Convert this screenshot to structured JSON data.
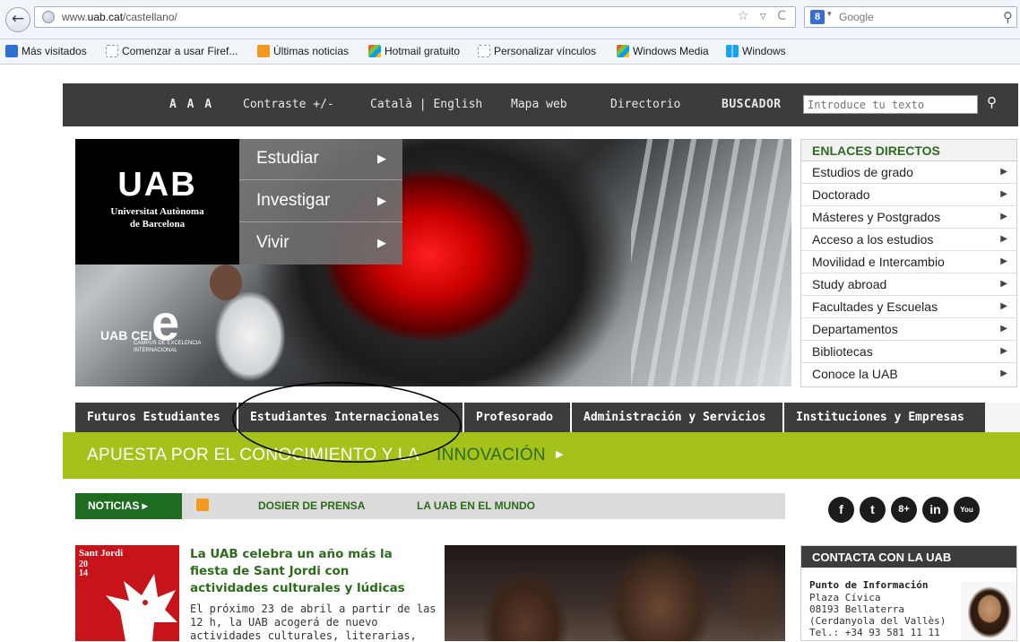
{
  "browser": {
    "back_icon": "back-arrow-icon",
    "url_prefix": "www.",
    "url_domain": "uab.cat",
    "url_path": "/castellano/",
    "url_icons": "☆ ▿ C",
    "search_engine_letter": "8",
    "search_engine_name": "Google",
    "bookmarks": [
      {
        "label": "Más visitados",
        "icon": "most-visited-icon"
      },
      {
        "label": "Comenzar a usar Firef...",
        "icon": "blank-page-icon"
      },
      {
        "label": "Últimas noticias",
        "icon": "rss-icon"
      },
      {
        "label": "Hotmail gratuito",
        "icon": "msn-butterfly-icon"
      },
      {
        "label": "Personalizar vínculos",
        "icon": "blank-page-icon"
      },
      {
        "label": "Windows Media",
        "icon": "msn-butterfly-icon"
      },
      {
        "label": "Windows",
        "icon": "windows-logo-icon"
      }
    ]
  },
  "util_bar": {
    "font_size": "A A A",
    "contrast": "Contraste +/-",
    "languages": "Català | English",
    "sitemap": "Mapa web",
    "directory": "Directorio",
    "search_label": "BUSCADOR",
    "search_placeholder": "Introduce tu texto"
  },
  "hero": {
    "logo_mark": "UAB",
    "logo_line1": "Universitat Autònoma",
    "logo_line2": "de Barcelona",
    "cei_letter": "e",
    "cei_uab": "UAB CEI",
    "cei_line1": "CAMPUS DE EXCELENCIA",
    "cei_line2": "INTERNACIONAL",
    "menu": [
      {
        "label": "Estudiar",
        "arrow": "▶"
      },
      {
        "label": "Investigar",
        "arrow": "▶"
      },
      {
        "label": "Vivir",
        "arrow": "▶"
      }
    ]
  },
  "enlaces": {
    "title": "ENLACES DIRECTOS",
    "arrow": "▶",
    "items": [
      "Estudios de grado",
      "Doctorado",
      "Másteres y Postgrados",
      "Acceso a los estudios",
      "Movilidad e Intercambio",
      "Study abroad",
      "Facultades y Escuelas",
      "Departamentos",
      "Bibliotecas",
      "Conoce la UAB"
    ]
  },
  "audience": [
    "Futuros Estudiantes",
    "Estudiantes Internacionales",
    "Profesorado",
    "Administración y Servicios",
    "Instituciones y Empresas"
  ],
  "banner": {
    "text_1": "APUESTA POR EL CONOCIMIENTO Y LA",
    "text_2": "INNOVACIÓN",
    "arrow": "▶"
  },
  "news_tabs": {
    "noticias": "NOTICIAS ▸",
    "dosier": "DOSIER DE PRENSA",
    "mundo": "LA UAB EN EL MUNDO"
  },
  "social": [
    {
      "icon": "facebook-icon",
      "glyph": "f"
    },
    {
      "icon": "twitter-icon",
      "glyph": "t"
    },
    {
      "icon": "googleplus-icon",
      "glyph": "8+"
    },
    {
      "icon": "linkedin-icon",
      "glyph": "in"
    },
    {
      "icon": "youtube-icon",
      "glyph": "You"
    }
  ],
  "news": {
    "thumb_title": "Sant Jordi",
    "thumb_year_1": "20",
    "thumb_year_2": "14",
    "headline_1": "La UAB celebra un año más la",
    "headline_2": "fiesta de Sant Jordi con",
    "headline_3": "actividades culturales y lúdicas",
    "body": [
      "El próximo 23 de abril a partir de las",
      "12 h, la UAB acogerá de nuevo",
      "actividades culturales, literarias,"
    ]
  },
  "contacta": {
    "title": "CONTACTA CON LA UAB",
    "heading": "Punto de Información",
    "lines": [
      "Plaza Cívica",
      "08193 Bellaterra",
      "(Cerdanyola del Vallès)",
      "Tel.: +34 93 581 11 11"
    ]
  },
  "colors": {
    "dark_bar": "#3c3c3c",
    "green_accent": "#2d6b1c",
    "lime_banner": "#a4c21a",
    "noticias_green": "#1e6b22"
  }
}
